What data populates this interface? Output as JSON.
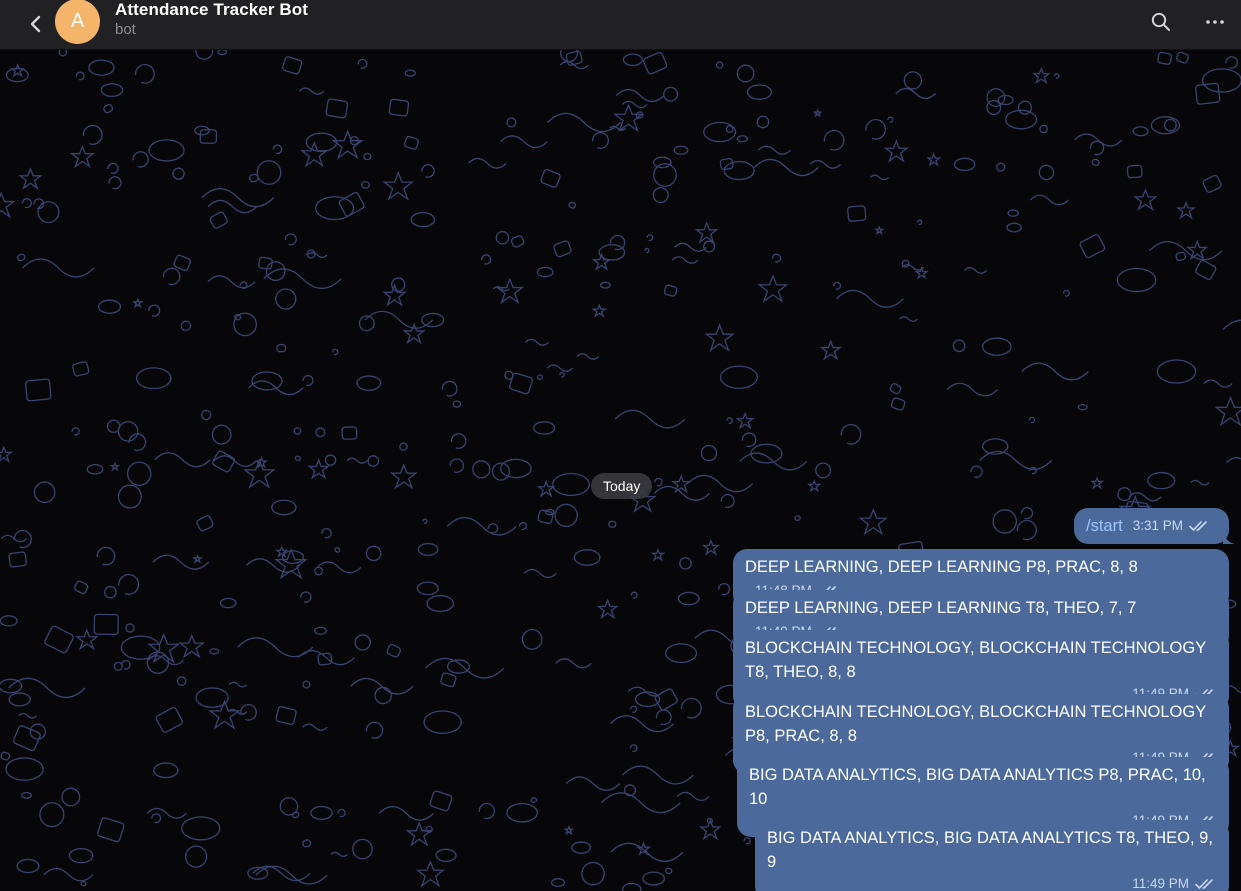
{
  "header": {
    "title": "Attendance Tracker Bot",
    "subtitle": "bot",
    "avatar_letter": "A"
  },
  "chat": {
    "date_separator": "Today",
    "messages": [
      {
        "text": "/start",
        "time": "3:31 PM",
        "is_command": true
      },
      {
        "text": "DEEP LEARNING, DEEP LEARNING P8, PRAC, 8, 8",
        "time": "11:48 PM"
      },
      {
        "text": "DEEP LEARNING, DEEP LEARNING T8, THEO, 7, 7",
        "time": "11:49 PM"
      },
      {
        "text": "BLOCKCHAIN TECHNOLOGY, BLOCKCHAIN TECHNOLOGY T8, THEO, 8, 8",
        "time": "11:49 PM"
      },
      {
        "text": "BLOCKCHAIN TECHNOLOGY, BLOCKCHAIN TECHNOLOGY P8, PRAC, 8, 8",
        "time": "11:49 PM"
      },
      {
        "text": "BIG DATA ANALYTICS, BIG DATA ANALYTICS P8, PRAC, 10, 10",
        "time": "11:49 PM"
      },
      {
        "text": "BIG DATA ANALYTICS, BIG DATA ANALYTICS T8, THEO, 9, 9",
        "time": "11:49 PM"
      }
    ]
  },
  "icons": {
    "back": "chevron-left-icon",
    "search": "search-icon",
    "menu": "more-horizontal-icon",
    "read_receipt": "double-check-icon"
  },
  "colors": {
    "header_bg": "#212123",
    "outgoing_bubble": "#4b6a9b",
    "avatar": "#f4b46a",
    "chat_bg": "#070709",
    "doodle_stroke": "#3a4370"
  }
}
